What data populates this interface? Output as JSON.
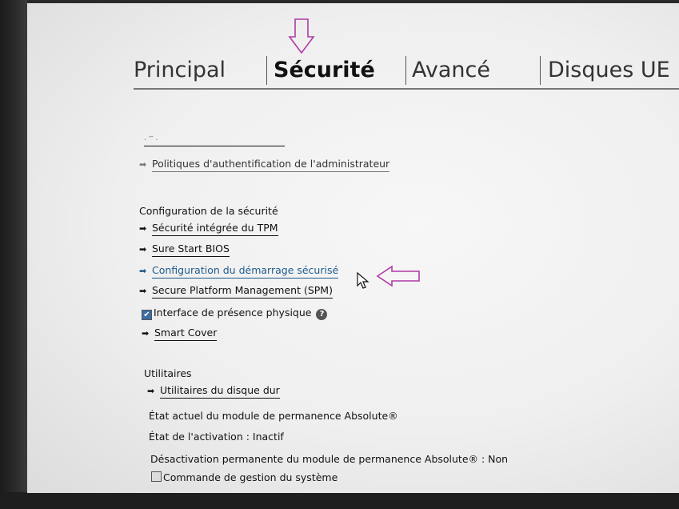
{
  "tabs": [
    {
      "label": "Principal",
      "active": false
    },
    {
      "label": "Sécurité",
      "active": true
    },
    {
      "label": "Avancé",
      "active": false
    },
    {
      "label": "Disques UE",
      "active": false
    }
  ],
  "top_partial": "·  ‾  ·",
  "admin_policies": "Politiques d'authentification de l'administrateur",
  "security_config": {
    "heading": "Configuration de la sécurité",
    "items": [
      {
        "label": "Sécurité intégrée du TPM"
      },
      {
        "label": "Sure Start BIOS"
      },
      {
        "label": "Configuration du démarrage sécurisé",
        "selected": true
      },
      {
        "label": "Secure Platform Management (SPM)"
      }
    ],
    "physical_presence": {
      "label": "Interface de présence physique",
      "checked": true,
      "help": "?"
    },
    "smart_cover": "Smart Cover"
  },
  "utilities": {
    "heading": "Utilitaires",
    "disk_utils": "Utilitaires du disque dur",
    "absolute_state": "État actuel du module de permanence Absolute®",
    "activation_state": "État de l'activation : Inactif",
    "permanent_disable": "Désactivation permanente du module de permanence Absolute® : Non",
    "system_mgmt": {
      "label": "Commande de gestion du système",
      "checked": false
    }
  },
  "colors": {
    "selected": "#1e5a8c",
    "annotation": "#b03aa6"
  }
}
